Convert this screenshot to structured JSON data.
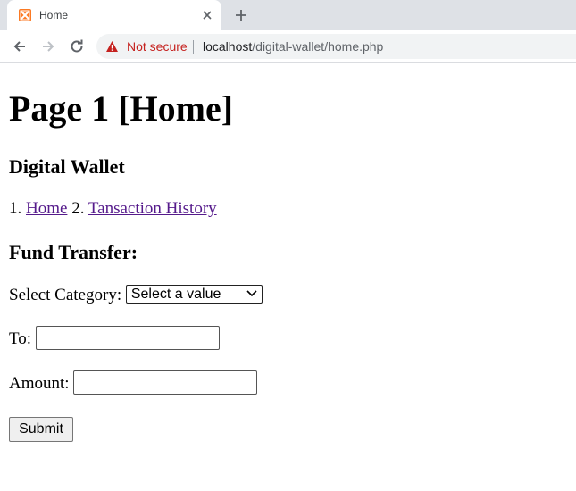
{
  "browser": {
    "tab_title": "Home",
    "security_label": "Not secure",
    "url_host": "localhost",
    "url_path": "/digital-wallet/home.php"
  },
  "page": {
    "heading": "Page 1 [Home]",
    "subheading": "Digital Wallet",
    "nav": {
      "item1_prefix": "1.",
      "item1_link": "Home",
      "item2_prefix": "2.",
      "item2_link": "Tansaction History"
    },
    "form": {
      "title": "Fund Transfer:",
      "category_label": "Select Category:",
      "category_selected": "Select a value",
      "to_label": "To:",
      "amount_label": "Amount:",
      "submit_label": "Submit"
    }
  },
  "colors": {
    "tabstrip": "#dee1e6",
    "not_secure": "#c5221f",
    "visited_link": "#551a8b"
  }
}
